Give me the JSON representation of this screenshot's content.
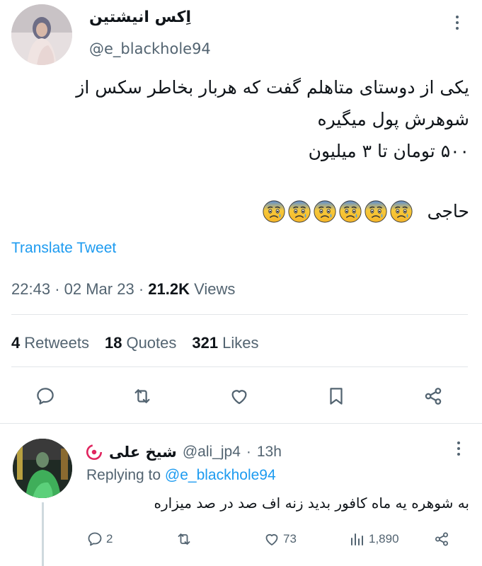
{
  "tweet": {
    "display_name": "اِکس انیشتین",
    "handle": "@e_blackhole94",
    "lines": [
      "یکی از دوستای متاهلم گفت که هربار بخاطر سکس از",
      "شوهرش پول میگیره",
      "۵۰۰ تومان تا ۳ میلیون"
    ],
    "last_line": "حاجی",
    "emoji_count": 6,
    "translate_label": "Translate Tweet",
    "time": "22:43",
    "date": "02 Mar 23",
    "views_count": "21.2K",
    "views_label": "Views",
    "retweets_count": "4",
    "retweets_label": "Retweets",
    "quotes_count": "18",
    "quotes_label": "Quotes",
    "likes_count": "321",
    "likes_label": "Likes"
  },
  "reply": {
    "display_name": "شیخ علی",
    "handle": "@ali_jp4",
    "time": "13h",
    "replying_prefix": "Replying to",
    "replying_to": "@e_blackhole94",
    "text": "به شوهره یه ماه کافور بدید زنه اف صد در صد میزاره",
    "reply_count": "2",
    "like_count": "73",
    "views_count": "1,890"
  },
  "colors": {
    "accent": "#1d9bf0",
    "secondary_text": "#536471",
    "divider": "#e2e6e9"
  },
  "icons": [
    "more-icon",
    "reply-icon",
    "retweet-icon",
    "like-icon",
    "bookmark-icon",
    "share-icon",
    "views-icon",
    "emoji-icon"
  ]
}
